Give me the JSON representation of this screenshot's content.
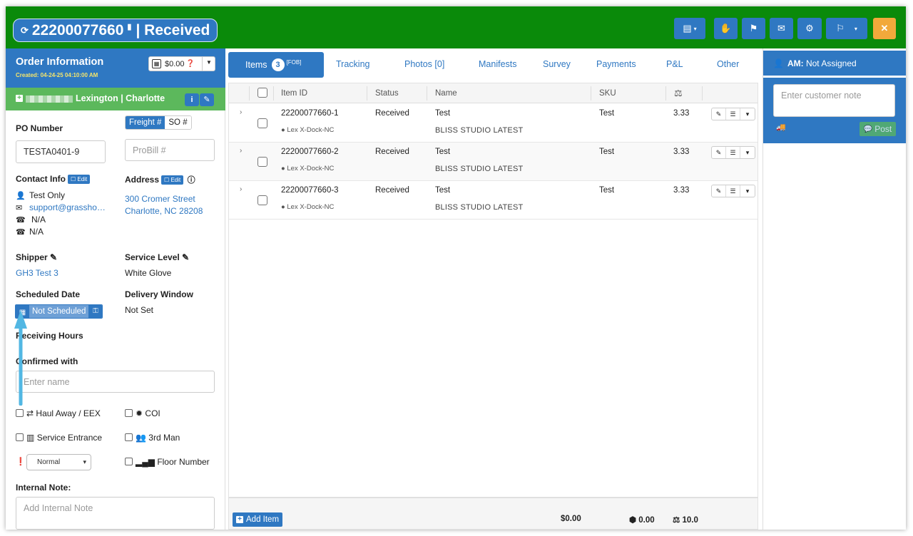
{
  "header": {
    "order_number": "22200077660",
    "status": "| Received",
    "icons": [
      "sync-icon",
      "copy-icon",
      "document-icon",
      "hand-icon",
      "flag-icon",
      "envelope-icon",
      "gear-icon",
      "flag-checkered-icon",
      "close-icon"
    ],
    "colors": {
      "bar": "#0a8a0a",
      "button": "#2f78c2",
      "close": "#f2a93b"
    }
  },
  "order_info": {
    "title": "Order Information",
    "created": "Created: 04-24-25 04:10:00 AM",
    "amount": "$0.00",
    "customer": "Lexington | Charlotte",
    "po_label": "PO Number",
    "po_value": "TESTA0401-9",
    "freight_label": "Freight #",
    "so_label": "SO #",
    "probill_placeholder": "ProBill #",
    "contact_label": "Contact Info",
    "edit_label": "Edit",
    "address_label": "Address",
    "contact_name": "Test Only",
    "contact_email": "support@grassho…",
    "phone1": "N/A",
    "phone2": "N/A",
    "address_line1": "300 Cromer Street",
    "address_line2": "Charlotte, NC 28208",
    "shipper_label": "Shipper",
    "shipper_value": "GH3 Test 3",
    "service_label": "Service Level",
    "service_value": "White Glove",
    "sched_label": "Scheduled Date",
    "sched_value": "Not Scheduled",
    "window_label": "Delivery Window",
    "window_value": "Not Set",
    "receiving_label": "Receiving Hours",
    "confirmed_label": "Confirmed with",
    "confirmed_placeholder": "Enter name",
    "haul_label": "Haul Away / EEX",
    "coi_label": "COI",
    "service_entrance_label": "Service Entrance",
    "third_man_label": "3rd Man",
    "priority_value": "Normal",
    "floor_label": "Floor Number",
    "internal_note_label": "Internal Note:",
    "internal_note_placeholder": "Add Internal Note"
  },
  "tabs": {
    "items": "Items",
    "items_count": "3",
    "items_tag": "[FOB]",
    "tracking": "Tracking",
    "photos": "Photos [0]",
    "manifests": "Manifests",
    "survey": "Survey",
    "payments": "Payments",
    "pl": "P&L",
    "other": "Other"
  },
  "grid": {
    "columns": {
      "item_id": "Item ID",
      "status": "Status",
      "name": "Name",
      "sku": "SKU",
      "weight_icon": "balance-scale-icon"
    },
    "rows": [
      {
        "item_id": "22200077660-1",
        "location": "Lex X-Dock-NC",
        "status": "Received",
        "name": "Test",
        "desc": "BLISS STUDIO LATEST",
        "sku": "Test",
        "weight": "3.33"
      },
      {
        "item_id": "22200077660-2",
        "location": "Lex X-Dock-NC",
        "status": "Received",
        "name": "Test",
        "desc": "BLISS STUDIO LATEST",
        "sku": "Test",
        "weight": "3.33"
      },
      {
        "item_id": "22200077660-3",
        "location": "Lex X-Dock-NC",
        "status": "Received",
        "name": "Test",
        "desc": "BLISS STUDIO LATEST",
        "sku": "Test",
        "weight": "3.33"
      }
    ],
    "footer": {
      "add_label": "Add Item",
      "total_price": "$0.00",
      "total_volume": "0.00",
      "total_weight": "10.0"
    }
  },
  "right_panel": {
    "am_prefix": "AM:",
    "am_value": "Not Assigned",
    "note_placeholder": "Enter customer note",
    "post_label": "Post"
  }
}
